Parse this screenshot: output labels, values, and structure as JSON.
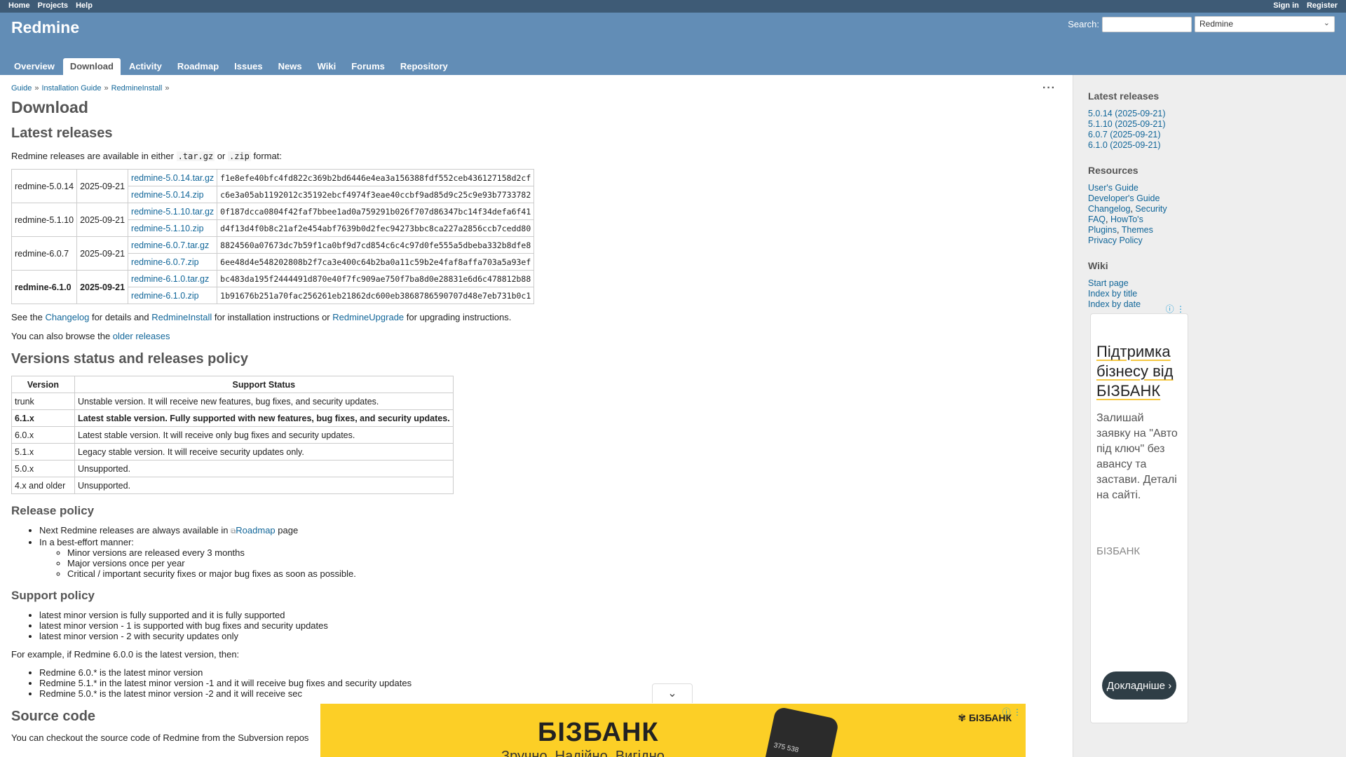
{
  "top_menu": {
    "left": [
      "Home",
      "Projects",
      "Help"
    ],
    "right": [
      "Sign in",
      "Register"
    ]
  },
  "header": {
    "title": "Redmine",
    "search_label": "Search:",
    "project_select": "Redmine"
  },
  "tabs": [
    "Overview",
    "Download",
    "Activity",
    "Roadmap",
    "Issues",
    "News",
    "Wiki",
    "Forums",
    "Repository"
  ],
  "breadcrumb": [
    "Guide",
    "Installation Guide",
    "RedmineInstall"
  ],
  "page": {
    "title": "Download",
    "latest_heading": "Latest releases",
    "formats_text_1": "Redmine releases are available in either",
    "format_targz": ".tar.gz",
    "formats_or": "or",
    "format_zip": ".zip",
    "formats_text_2": "format:",
    "see_the": "See the",
    "changelog": "Changelog",
    "for_details": "for details and",
    "redmine_install": "RedmineInstall",
    "for_install": "for installation instructions or",
    "redmine_upgrade": "RedmineUpgrade",
    "for_upgrade": "for upgrading instructions.",
    "browse_text": "You can also browse the",
    "older_releases": "older releases",
    "versions_heading": "Versions status and releases policy",
    "release_policy_heading": "Release policy",
    "release_policy_1_pre": "Next Redmine releases are always available in",
    "release_policy_1_link": "Roadmap",
    "release_policy_1_post": "page",
    "release_policy_2": "In a best-effort manner:",
    "release_policy_sub": [
      "Minor versions are released every 3 months",
      "Major versions once per year",
      "Critical / important security fixes or major bug fixes as soon as possible."
    ],
    "support_policy_heading": "Support policy",
    "support_policy": [
      "latest minor version is fully supported and it is fully supported",
      "latest minor version - 1 is supported with bug fixes and security updates",
      "latest minor version - 2 with security updates only"
    ],
    "example_text": "For example, if Redmine 6.0.0 is the latest version, then:",
    "example_items": [
      "Redmine 6.0.* is the latest minor version",
      "Redmine 5.1.* in the latest minor version -1 and it will receive bug fixes and security updates",
      "Redmine 5.0.* is the latest minor version -2 and it will receive sec"
    ],
    "source_heading": "Source code",
    "source_text": "You can checkout the source code of Redmine from the Subversion repos"
  },
  "releases": [
    {
      "name": "redmine-5.0.14",
      "date": "2025-09-21",
      "bold": false,
      "files": [
        {
          "file": "redmine-5.0.14.tar.gz",
          "sha": "f1e8efe40bfc4fd822c369b2bd6446e4ea3a156388fdf552ceb436127158d2cf"
        },
        {
          "file": "redmine-5.0.14.zip",
          "sha": "c6e3a05ab1192012c35192ebcf4974f3eae40ccbf9ad85d9c25c9e93b7733782"
        }
      ]
    },
    {
      "name": "redmine-5.1.10",
      "date": "2025-09-21",
      "bold": false,
      "files": [
        {
          "file": "redmine-5.1.10.tar.gz",
          "sha": "0f187dcca0804f42faf7bbee1ad0a759291b026f707d86347bc14f34defa6f41"
        },
        {
          "file": "redmine-5.1.10.zip",
          "sha": "d4f13d4f0b8c21af2e454abf7639b0d2fec94273bbc8ca227a2856ccb7cedd80"
        }
      ]
    },
    {
      "name": "redmine-6.0.7",
      "date": "2025-09-21",
      "bold": false,
      "files": [
        {
          "file": "redmine-6.0.7.tar.gz",
          "sha": "8824560a07673dc7b59f1ca0bf9d7cd854c6c4c97d0fe555a5dbeba332b8dfe8"
        },
        {
          "file": "redmine-6.0.7.zip",
          "sha": "6ee48d4e548202808b2f7ca3e400c64b2ba0a11c59b2e4faf8affa703a5a93ef"
        }
      ]
    },
    {
      "name": "redmine-6.1.0",
      "date": "2025-09-21",
      "bold": true,
      "files": [
        {
          "file": "redmine-6.1.0.tar.gz",
          "sha": "bc483da195f2444491d870e40f7fc909ae750f7ba8d0e28831e6d6c478812b88"
        },
        {
          "file": "redmine-6.1.0.zip",
          "sha": "1b91676b251a70fac256261eb21862dc600eb3868786590707d48e7eb731b0c1"
        }
      ]
    }
  ],
  "versions_table": {
    "headers": [
      "Version",
      "Support Status"
    ],
    "rows": [
      {
        "version": "trunk",
        "status": "Unstable version. It will receive new features, bug fixes, and security updates.",
        "bold": false
      },
      {
        "version": "6.1.x",
        "status": "Latest stable version. Fully supported with new features, bug fixes, and security updates.",
        "bold": true
      },
      {
        "version": "6.0.x",
        "status": "Latest stable version. It will receive only bug fixes and security updates.",
        "bold": false
      },
      {
        "version": "5.1.x",
        "status": "Legacy stable version. It will receive security updates only.",
        "bold": false
      },
      {
        "version": "5.0.x",
        "status": "Unsupported.",
        "bold": false
      },
      {
        "version": "4.x and older",
        "status": "Unsupported.",
        "bold": false
      }
    ]
  },
  "sidebar": {
    "latest_heading": "Latest releases",
    "latest_links": [
      "5.0.14 (2025-09-21)",
      "5.1.10 (2025-09-21)",
      "6.0.7 (2025-09-21)",
      "6.1.0 (2025-09-21)"
    ],
    "resources_heading": "Resources",
    "resources": {
      "users_guide": "User's Guide",
      "developers_guide": "Developer's Guide",
      "changelog": "Changelog",
      "security": "Security",
      "faq": "FAQ",
      "howtos": "HowTo's",
      "plugins": "Plugins",
      "themes": "Themes",
      "privacy": "Privacy Policy"
    },
    "wiki_heading": "Wiki",
    "wiki_links": [
      "Start page",
      "Index by title",
      "Index by date"
    ]
  },
  "ad_side": {
    "headline": "Підтримка бізнесу від БІЗБАНК",
    "body": "Залишай заявку на \"Авто під ключ\" без авансу та застави. Деталі на сайті.",
    "brand": "БІЗБАНК",
    "cta": "Докладніше"
  },
  "ad_bottom": {
    "brand": "БІЗБАНК",
    "sub": "Зручно. Надійно. Вигідно",
    "phone_amount": "375 538",
    "logo": "БІЗБАНК"
  }
}
